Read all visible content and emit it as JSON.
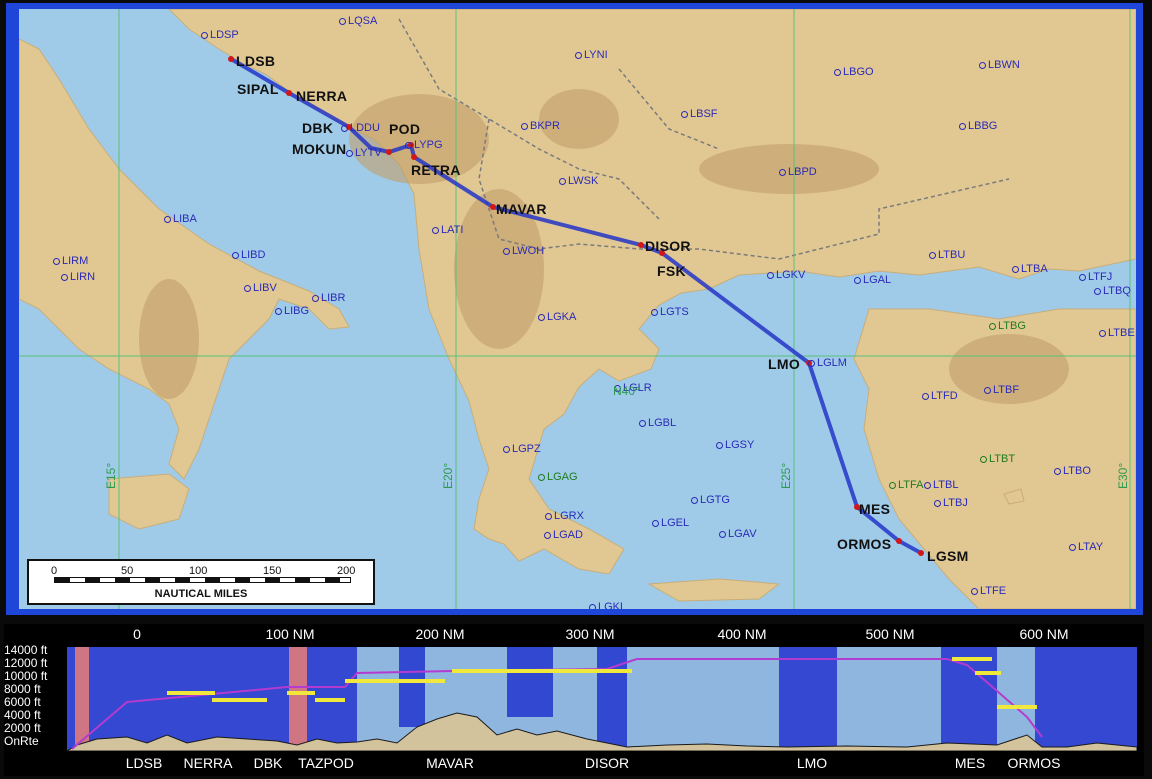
{
  "colors": {
    "frame": "#1e47d9",
    "sea": "#9fcbe8",
    "route": "#2535c8",
    "waypoint": "#d01818",
    "airport": "#2a2ab8",
    "grid": "#56c27a"
  },
  "map": {
    "waypoints": [
      "LDSB",
      "SIPAL",
      "NERRA",
      "DBK",
      "MOKUN",
      "POD",
      "RETRA",
      "MAVAR",
      "DISOR",
      "FSK",
      "LMO",
      "MES",
      "ORMOS",
      "LGSM"
    ],
    "airports_blue": [
      "LDSP",
      "LQSA",
      "LYNI",
      "LBGO",
      "LBWN",
      "LDDU",
      "LYPG",
      "BKPR",
      "LBSF",
      "LBBG",
      "LWSK",
      "LBPD",
      "LIBA",
      "LATI",
      "LIBD",
      "LWOH",
      "LIRM",
      "LIRN",
      "LIBV",
      "LIBR",
      "LIBG",
      "LGKV",
      "LGAL",
      "LTBU",
      "LTBA",
      "LTFJ",
      "LTBQ",
      "LGKA",
      "LGTS",
      "LGLM",
      "LTBE",
      "LGLR",
      "LTFD",
      "LTBF",
      "LGBL",
      "LGSY",
      "LGPZ",
      "LTBL",
      "LTBJ",
      "LTBO",
      "LGTG",
      "LGRX",
      "LGEL",
      "LGAD",
      "LGAV",
      "LTAY",
      "LTFE",
      "LGKL",
      "LYTV"
    ],
    "airports_green": [
      "LTBG",
      "LTBT",
      "LGAG",
      "LTFA"
    ],
    "grid_labels": [
      "N40°",
      "E15°",
      "E20°",
      "E25°",
      "E30°"
    ],
    "scale": {
      "ticks": [
        "0",
        "50",
        "100",
        "150",
        "200"
      ],
      "caption": "NAUTICAL MILES"
    }
  },
  "profile": {
    "distance_labels": [
      "0",
      "100 NM",
      "200 NM",
      "300 NM",
      "400 NM",
      "500 NM",
      "600 NM"
    ],
    "altitude_labels": [
      "14000 ft",
      "12000 ft",
      "10000 ft",
      "8000 ft",
      "6000 ft",
      "4000 ft",
      "2000 ft",
      "OnRte"
    ],
    "waypoint_labels": [
      "LDSB",
      "NERRA",
      "DBK",
      "TAZPOD",
      "MAVAR",
      "DISOR",
      "LMO",
      "MES",
      "ORMOS"
    ]
  }
}
